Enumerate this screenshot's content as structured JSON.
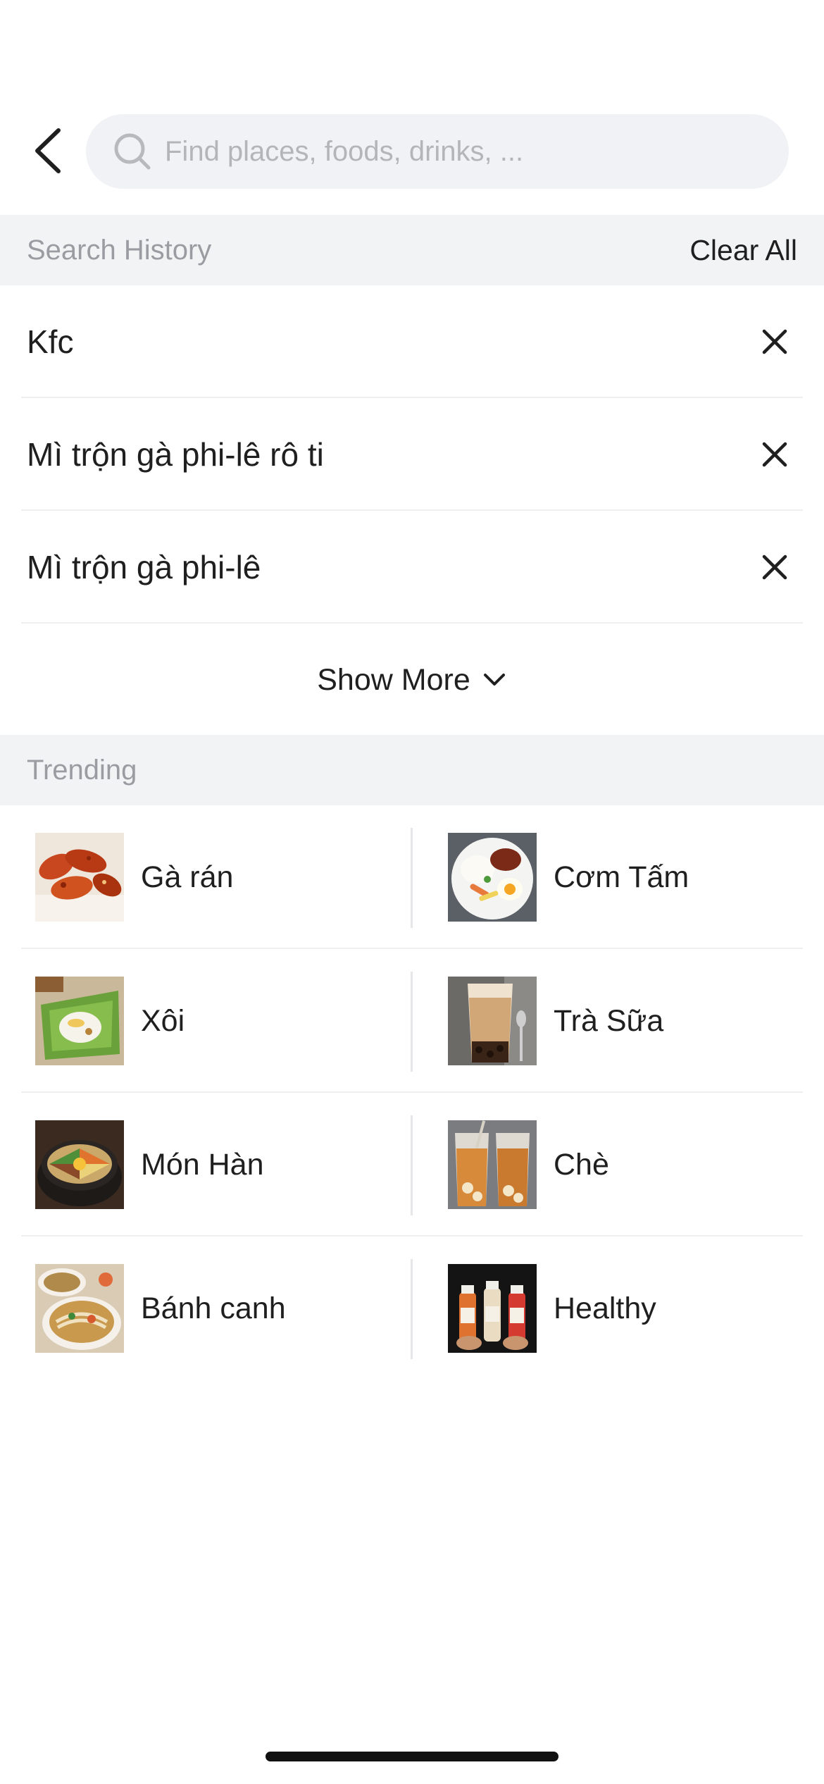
{
  "search": {
    "placeholder": "Find places, foods, drinks, ..."
  },
  "history": {
    "title": "Search History",
    "clear_all_label": "Clear All",
    "items": [
      {
        "label": "Kfc"
      },
      {
        "label": "Mì trộn gà phi-lê rô ti"
      },
      {
        "label": "Mì trộn gà phi-lê"
      }
    ],
    "show_more_label": "Show More"
  },
  "trending": {
    "title": "Trending",
    "items": [
      {
        "label": "Gà rán",
        "icon": "fried-chicken-thumb"
      },
      {
        "label": "Cơm Tấm",
        "icon": "broken-rice-thumb"
      },
      {
        "label": "Xôi",
        "icon": "sticky-rice-thumb"
      },
      {
        "label": "Trà Sữa",
        "icon": "milk-tea-thumb"
      },
      {
        "label": "Món Hàn",
        "icon": "korean-food-thumb"
      },
      {
        "label": "Chè",
        "icon": "sweet-soup-thumb"
      },
      {
        "label": "Bánh canh",
        "icon": "noodle-soup-thumb"
      },
      {
        "label": "Healthy",
        "icon": "juice-bottles-thumb"
      }
    ]
  },
  "colors": {
    "section_bg": "#f2f3f5",
    "muted_text": "#9a9ca1",
    "search_bg": "#f1f2f5"
  }
}
